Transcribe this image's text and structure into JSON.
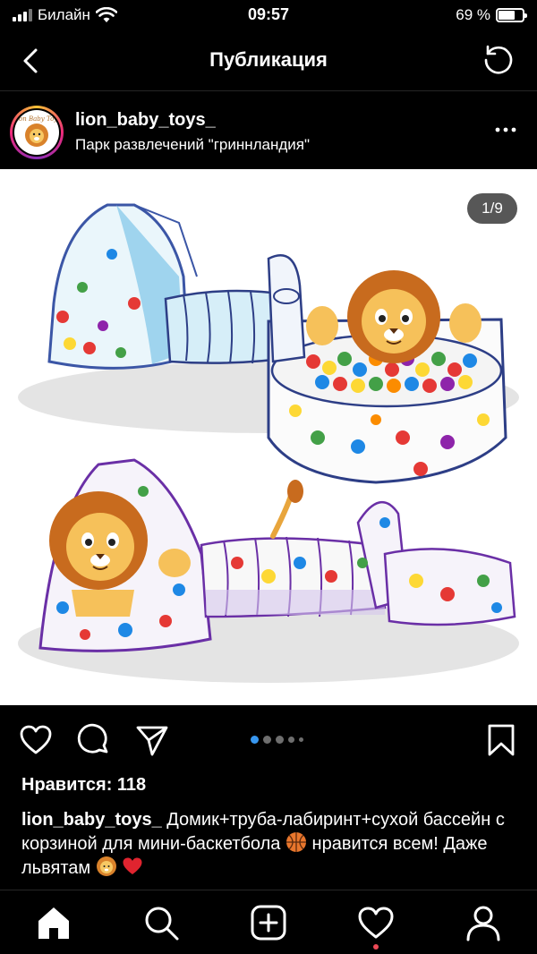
{
  "status_bar": {
    "carrier": "Билайн",
    "time": "09:57",
    "battery_percent": "69 %",
    "battery_level": 0.69
  },
  "nav": {
    "title": "Публикация",
    "back_icon": "chevron-left-icon",
    "refresh_icon": "refresh-icon"
  },
  "post": {
    "username": "lion_baby_toys_",
    "location": "Парк развлечений \"гриннландия\"",
    "more_icon": "more-horizontal-icon",
    "counter": "1/9",
    "likes": "Нравится: 118",
    "caption_user": "lion_baby_toys_",
    "caption_text": " Домик+труба-лабиринт+сухой бассейн с корзиной для мини-баскетбола ",
    "caption_text_2": " нравится всем! Даже львятам ",
    "carousel_total": 9,
    "carousel_index": 1
  },
  "tabs": [
    "home-icon",
    "search-icon",
    "new-post-icon",
    "activity-icon",
    "profile-icon"
  ],
  "colors": {
    "background": "#000000",
    "notification_dot": "#ed4956"
  }
}
